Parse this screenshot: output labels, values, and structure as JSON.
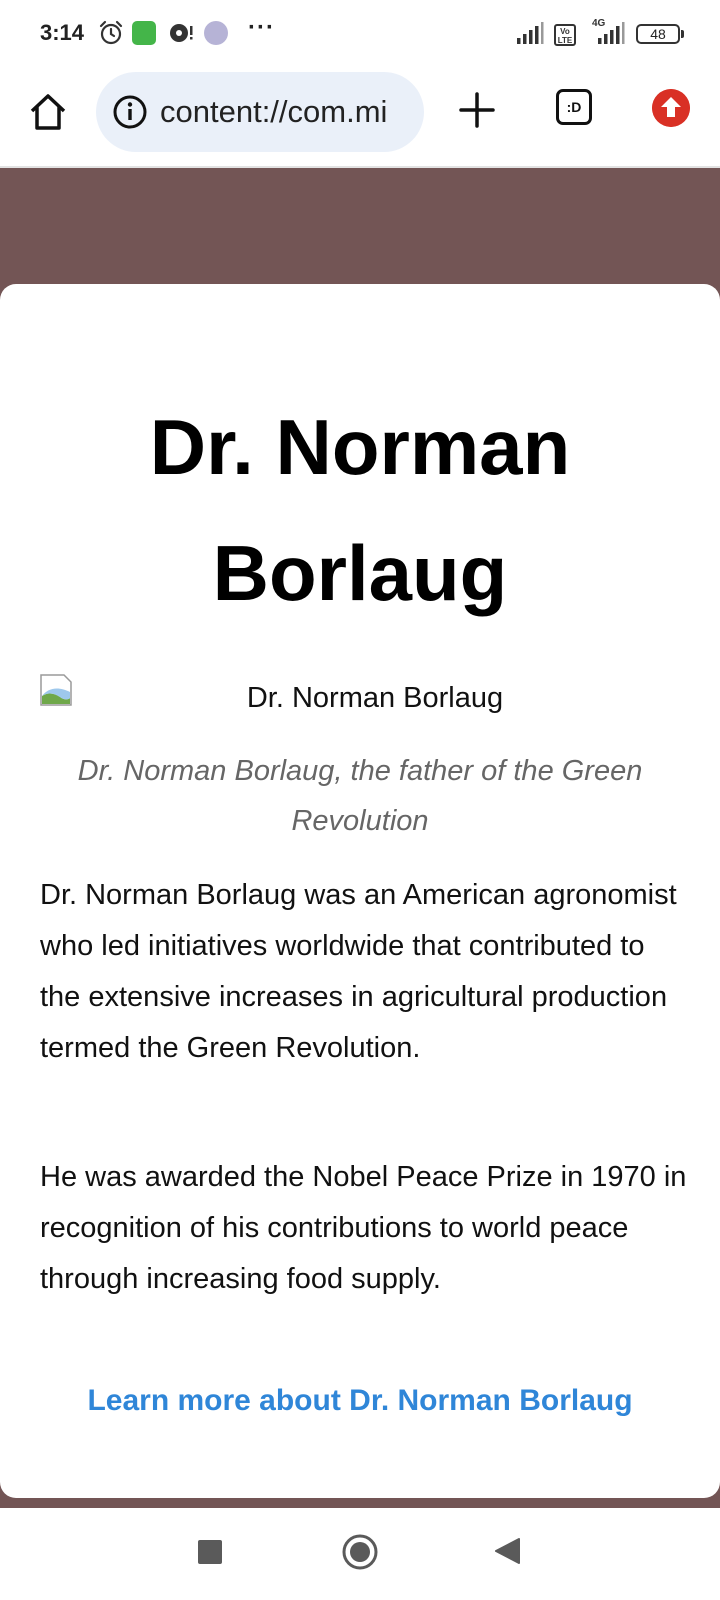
{
  "status_bar": {
    "time": "3:14",
    "more_indicator": "···",
    "volte_label": "Vo\nLTE",
    "network_label": "4G",
    "battery_level": "48",
    "icons": [
      "alarm-icon",
      "app-notification-icon",
      "music-notification-icon",
      "cast-notification-icon",
      "signal-icon",
      "volte-icon",
      "signal-4g-icon",
      "battery-icon"
    ]
  },
  "browser": {
    "url": "content://com.mi",
    "tabs_label": ":D",
    "icons": [
      "home-icon",
      "info-icon",
      "plus-icon",
      "tabs-icon",
      "update-icon"
    ]
  },
  "page": {
    "title": "Dr. Norman Borlaug",
    "image_alt": "Dr. Norman Borlaug",
    "caption": "Dr. Norman Borlaug, the father of the Green Revolution",
    "paragraphs": [
      "Dr. Norman Borlaug was an American agronomist who led initiatives worldwide that contributed to the extensive increases in agricultural production termed the Green Revolution.",
      "He was awarded the Nobel Peace Prize in 1970 in recognition of his contributions to world peace through increasing food supply."
    ],
    "link_text": "Learn more about Dr. Norman Borlaug"
  },
  "colors": {
    "page_background": "#735555",
    "link": "#2f86d8",
    "caption": "#666666",
    "url_bar": "#eaf0f9",
    "update_badge": "#d93025"
  },
  "nav_bar": {
    "icons": [
      "recents-icon",
      "home-circle-icon",
      "back-icon"
    ]
  }
}
